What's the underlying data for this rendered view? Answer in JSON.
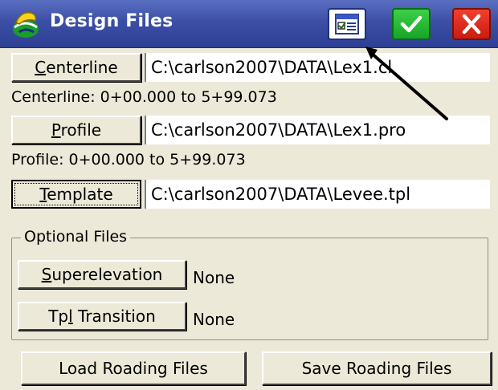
{
  "window": {
    "title": "Design Files",
    "icons": {
      "app": "carlson-app-icon",
      "options": "options-list-icon",
      "ok": "checkmark-icon",
      "close": "close-icon"
    },
    "colors": {
      "titlebar": "#3c4fa6",
      "ok": "#16a524",
      "close": "#c81d10",
      "background": "#ece9d8"
    }
  },
  "files": {
    "centerline": {
      "button_first": "C",
      "button_rest": "enterline",
      "path": "C:\\carlson2007\\DATA\\Lex1.cl",
      "info": "Centerline: 0+00.000 to 5+99.073"
    },
    "profile": {
      "button_first": "P",
      "button_rest": "rofile",
      "path": "C:\\carlson2007\\DATA\\Lex1.pro",
      "info": "Profile: 0+00.000 to 5+99.073"
    },
    "template": {
      "button_first": "T",
      "button_rest": "emplate",
      "path": "C:\\carlson2007\\DATA\\Levee.tpl"
    }
  },
  "optional": {
    "label": "Optional Files",
    "superelevation": {
      "button_first": "S",
      "button_rest": "uperelevation",
      "value": "None"
    },
    "tpl_transition": {
      "button_before": "Tp",
      "button_underlined": "l",
      "button_after": " Transition",
      "value": "None"
    }
  },
  "footer": {
    "load_label": "Load Roading Files",
    "save_label": "Save Roading Files"
  }
}
